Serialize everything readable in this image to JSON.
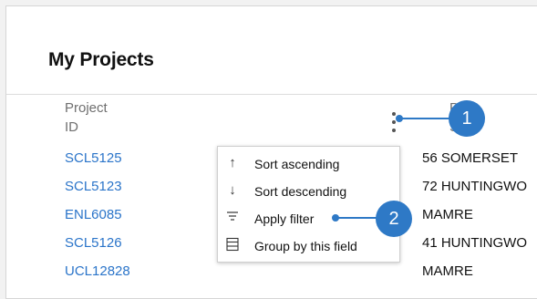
{
  "panel": {
    "title": "My Projects"
  },
  "table": {
    "columns": [
      {
        "line1": "Project",
        "line2": "ID"
      },
      {
        "line1": "Pr",
        "line2": "Str"
      }
    ],
    "column_menu_icon": "kebab-vertical-icon",
    "rows": [
      {
        "id": "SCL5125",
        "street": "56 SOMERSET"
      },
      {
        "id": "SCL5123",
        "street": "72 HUNTINGWO"
      },
      {
        "id": "ENL6085",
        "street": "MAMRE"
      },
      {
        "id": "SCL5126",
        "street": "41 HUNTINGWO"
      },
      {
        "id": "UCL12828",
        "street": "MAMRE"
      }
    ]
  },
  "context_menu": {
    "items": [
      {
        "icon": "arrow-up-icon",
        "label": "Sort ascending"
      },
      {
        "icon": "arrow-down-icon",
        "label": "Sort descending"
      },
      {
        "icon": "filter-icon",
        "label": "Apply filter"
      },
      {
        "icon": "group-icon",
        "label": "Group by this field"
      }
    ]
  },
  "callouts": [
    {
      "number": "1"
    },
    {
      "number": "2"
    }
  ],
  "colors": {
    "accent": "#2e79c6",
    "link": "#2a74c9"
  }
}
